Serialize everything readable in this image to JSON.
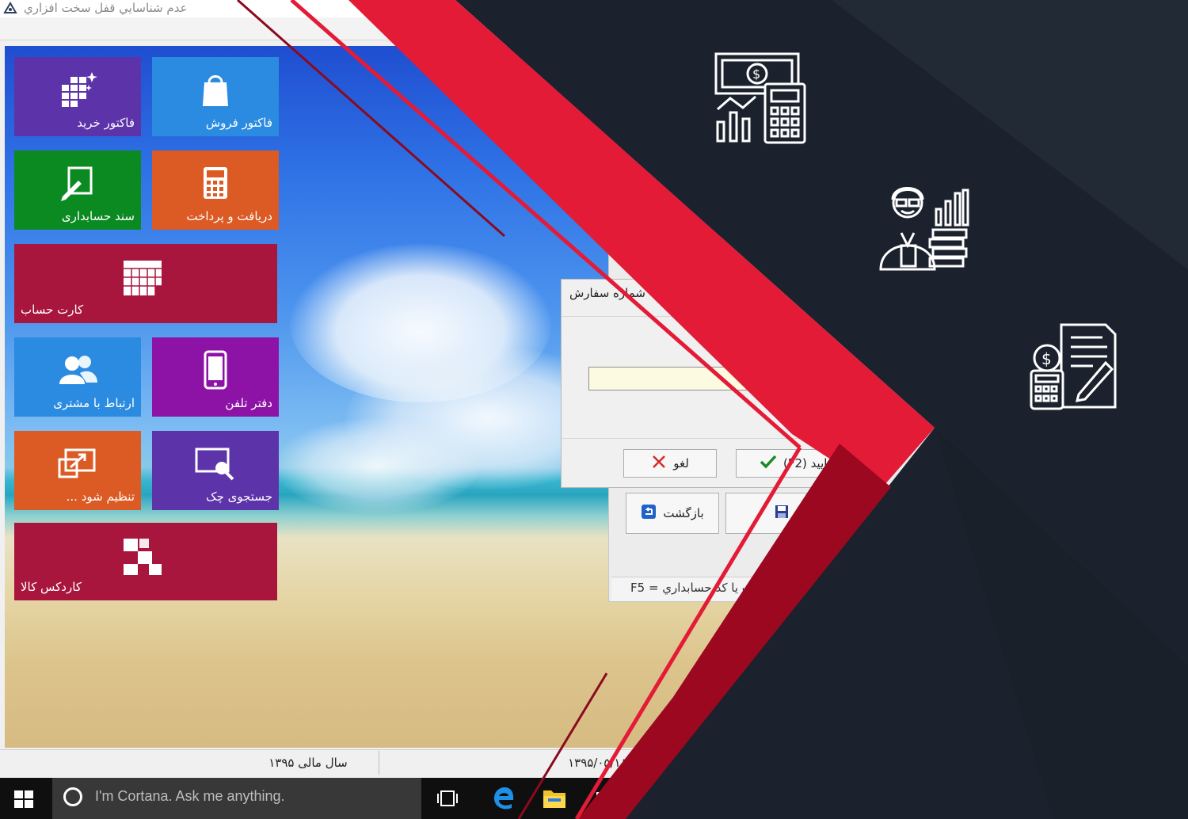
{
  "window": {
    "title": "عدم شناسايي قفل سخت افزاري",
    "icon": "app-icon"
  },
  "tiles": [
    {
      "id": "purchase-invoice",
      "label": "فاکتور خرید",
      "color": "#5c33a8",
      "icon": "grid-sparkle-icon"
    },
    {
      "id": "sales-invoice",
      "label": "فاکتور فروش",
      "color": "#2b8be0",
      "icon": "shopping-bag-icon"
    },
    {
      "id": "accounting-voucher",
      "label": "سند حسابداری",
      "color": "#0b8a22",
      "icon": "edit-document-icon"
    },
    {
      "id": "receive-pay",
      "label": "دریافت و پرداخت",
      "color": "#dc5a23",
      "icon": "calculator-icon"
    },
    {
      "id": "account-card",
      "label": "کارت حساب",
      "color": "#a8163e",
      "icon": "calendar-icon"
    },
    {
      "id": "customer-relation",
      "label": "ارتباط با مشتری",
      "color": "#2b8be0",
      "icon": "users-icon"
    },
    {
      "id": "phone-book",
      "label": "دفتر تلفن",
      "color": "#8d13a6",
      "icon": "phone-icon"
    },
    {
      "id": "settings-tile",
      "label": "تنظیم شود ...",
      "color": "#dc5a23",
      "icon": "external-window-icon"
    },
    {
      "id": "check-search",
      "label": "جستجوی چک",
      "color": "#5c33a8",
      "icon": "search-window-icon"
    },
    {
      "id": "goods-cardex",
      "label": "کاردکس کالا",
      "color": "#a8163e",
      "icon": "blocks-icon"
    }
  ],
  "dialog": {
    "title": "شماره سفارش",
    "input_value": "",
    "cancel_label": "لغو",
    "confirm_label": "تاييد (F2)"
  },
  "background_window": {
    "back_label": "بازگشت",
    "save_label": "ثبت",
    "hint": "F5 = حساب يا کد حسابداري"
  },
  "statusbar": {
    "fiscal_year": "سال مالی ۱۳۹۵",
    "date": "دوشنبه ۱۳۹۵/۰۵/۱۸"
  },
  "taskbar": {
    "search_placeholder": "I'm Cortana. Ask me anything.",
    "apps": [
      "task-view-icon",
      "edge-icon",
      "file-explorer-icon",
      "store-icon"
    ]
  },
  "colors": {
    "accent_red": "#e31b37",
    "dark_red": "#9b0820",
    "navy": "#1b222d"
  },
  "decorative_icons": [
    "money-calculator-icon",
    "accountant-icon",
    "invoice-calculator-icon"
  ]
}
